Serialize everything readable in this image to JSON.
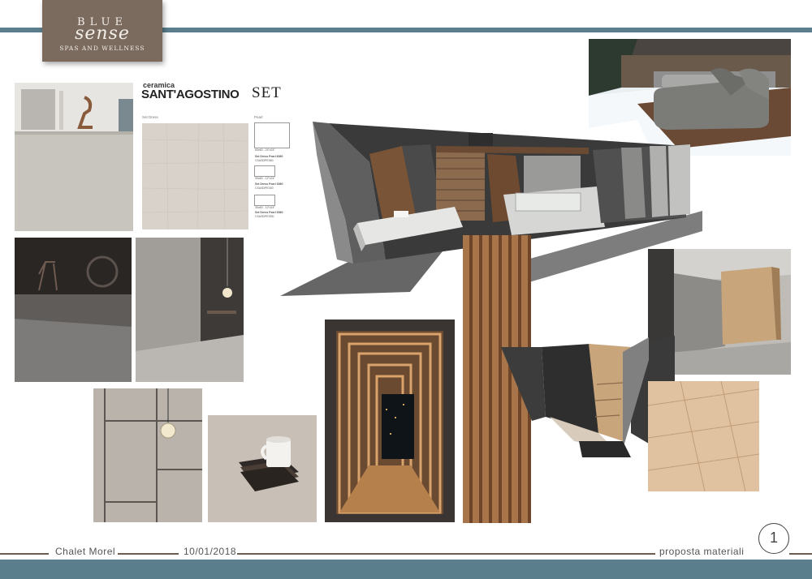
{
  "logo": {
    "line1": "BLUE",
    "line2": "sense",
    "line3": "SPAS AND WELLNESS"
  },
  "brand": {
    "line1": "ceramica",
    "line2": "SANT'AGOSTINO",
    "set": "SET"
  },
  "swatches": {
    "main_label": "Set Dress",
    "side_label": "Pearl",
    "items": [
      {
        "size": "60x60 - 24\"x24\"",
        "name": "Set Dress Pearl 6060",
        "code": "CSASDPE060"
      },
      {
        "size": "30x60 - 12\"x24\"",
        "name": "Set Dress Pearl 3060",
        "code": "CSASDPE030"
      },
      {
        "size": "30x60 - 12\"x24\"",
        "name": "Set Dress Pearl 3060",
        "code": "CSASDPE0SD"
      }
    ]
  },
  "footer": {
    "project": "Chalet Morel",
    "date": "10/01/2018",
    "section": "proposta materiali",
    "page": "1"
  },
  "colors": {
    "band": "#5a7e8c",
    "logo_bg": "#7a6b5e",
    "footer_line": "#6b5d50"
  }
}
